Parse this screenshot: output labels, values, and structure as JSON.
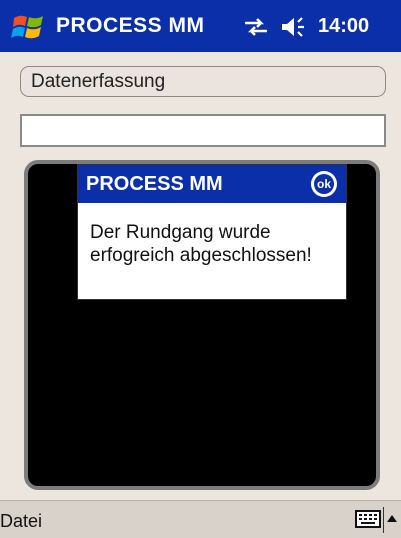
{
  "titlebar": {
    "app_title": "PROCESS MM",
    "clock": "14:00",
    "icons": [
      "windows-start-icon",
      "sync-icon",
      "volume-icon"
    ]
  },
  "form": {
    "section_label": "Datenerfassung",
    "text_input_value": ""
  },
  "dialog": {
    "title": "PROCESS MM",
    "ok_label": "ok",
    "message": "Der Rundgang wurde erfogreich abgeschlossen!"
  },
  "menubar": {
    "menu_label": "Datei",
    "icons": [
      "keyboard-icon",
      "sip-arrow-icon"
    ]
  },
  "colors": {
    "titlebar": "#0a2fa8",
    "background": "#ede6df",
    "panel": "#000000",
    "menubar": "#d9d2cb"
  }
}
